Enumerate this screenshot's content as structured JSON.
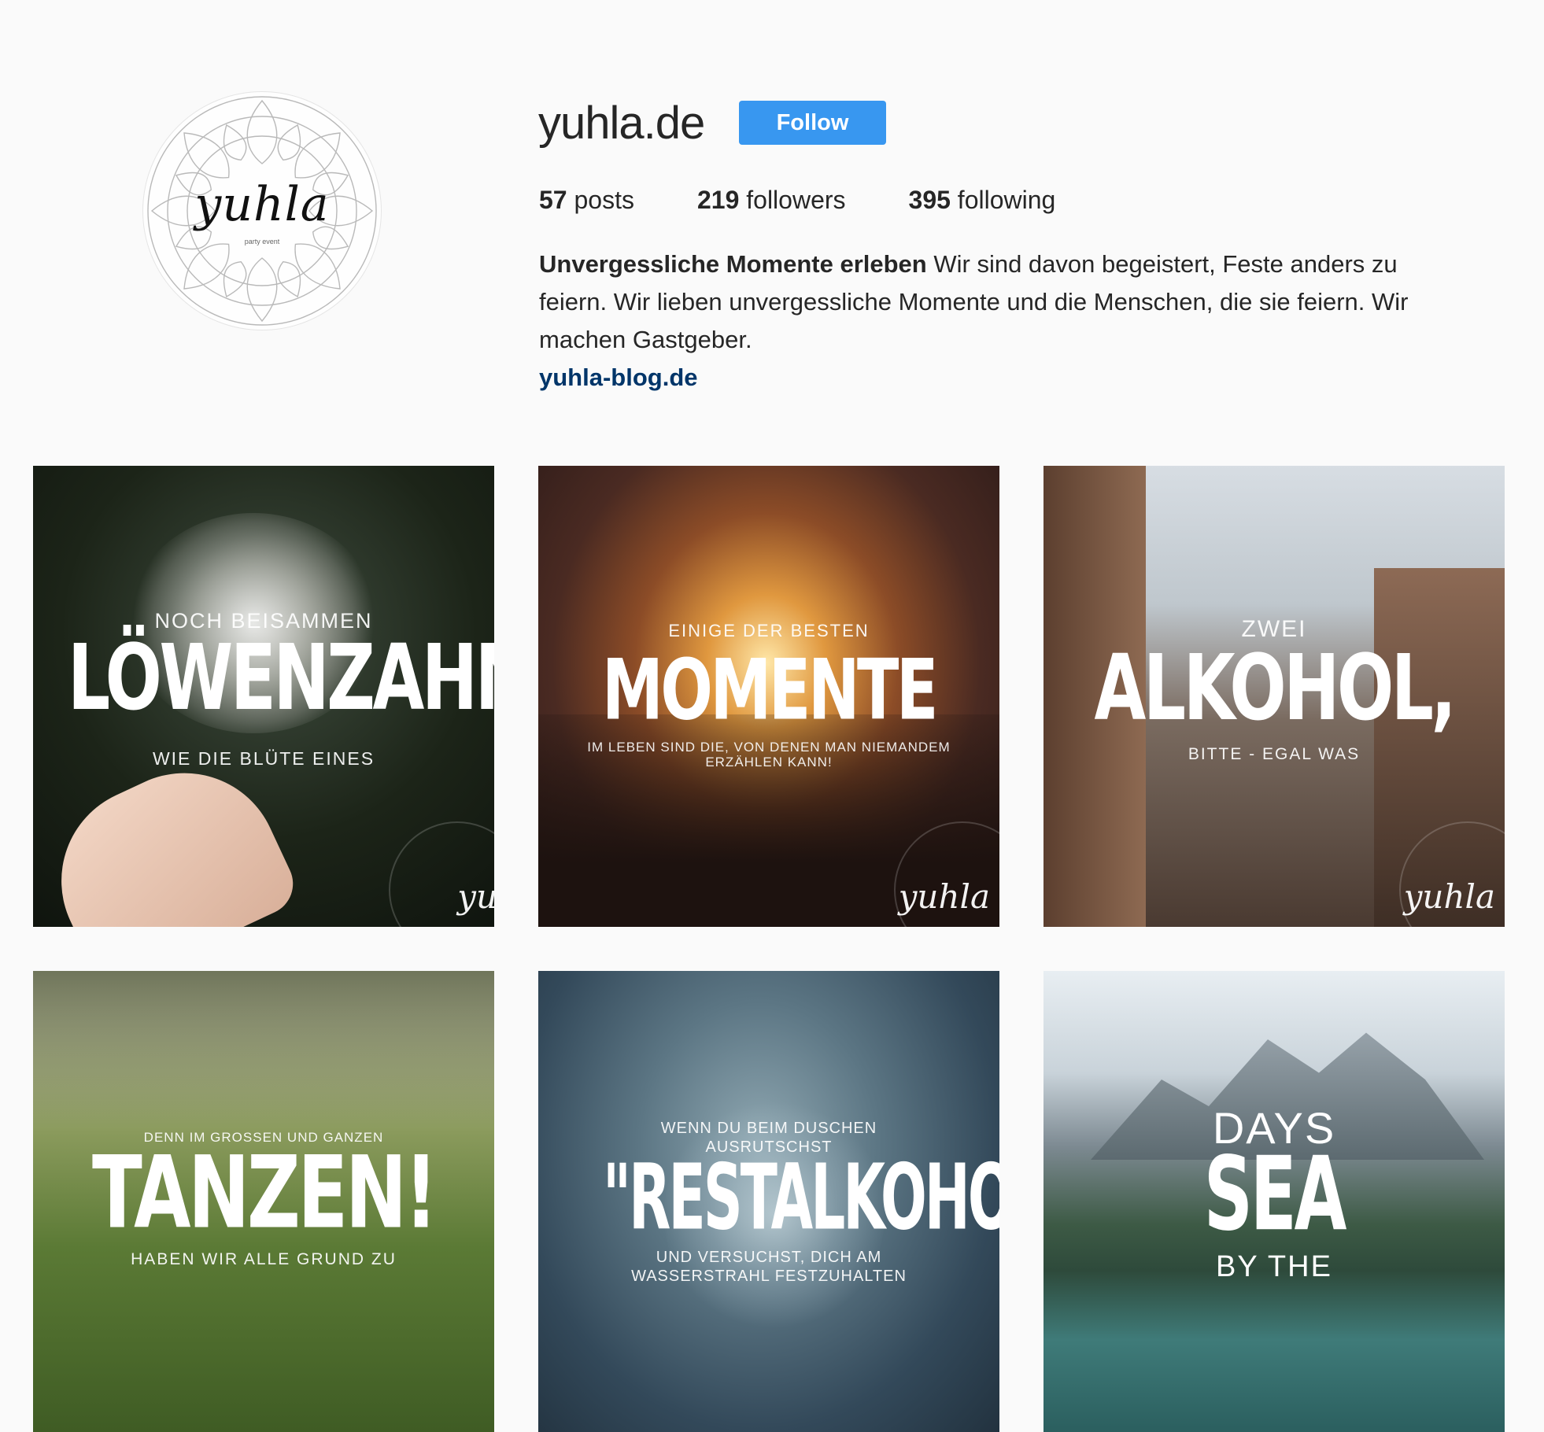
{
  "profile": {
    "avatar_wordmark": "yuhla",
    "avatar_subtitle": "party event",
    "username": "yuhla.de",
    "follow_label": "Follow",
    "stats": {
      "posts_count": "57",
      "posts_label": "posts",
      "followers_count": "219",
      "followers_label": "followers",
      "following_count": "395",
      "following_label": "following"
    },
    "bio": {
      "name": "Unvergessliche Momente erleben",
      "text": "Wir sind davon begeistert, Feste anders zu feiern. Wir lieben unvergessliche Momente und die Menschen, die sie feiern. Wir machen Gastgeber.",
      "link": "yuhla-blog.de"
    }
  },
  "posts": [
    {
      "top": "NOCH BEISAMMEN",
      "big": "LÖWENZAHN",
      "bottom": "WIE DIE BLÜTE EINES",
      "watermark": "yu"
    },
    {
      "top": "EINIGE DER BESTEN",
      "big": "MOMENTE",
      "bottom": "IM LEBEN SIND DIE, VON DENEN MAN NIEMANDEM ERZÄHLEN KANN!",
      "watermark": "yuhla"
    },
    {
      "top": "ZWEI",
      "big": "ALKOHOL,",
      "bottom": "BITTE - EGAL WAS",
      "watermark": "yuhla"
    },
    {
      "top": "DENN IM GROSSEN UND GANZEN",
      "big": "TANZEN!",
      "bottom": "HABEN WIR ALLE GRUND ZU"
    },
    {
      "top": "WENN DU BEIM DUSCHEN AUSRUTSCHST",
      "big": "\"RESTALKOHOL\"",
      "bottom": "UND VERSUCHST, DICH AM WASSERSTRAHL FESTZUHALTEN"
    },
    {
      "top": "DAYS",
      "big": "SEA",
      "bottom": "BY THE"
    }
  ],
  "colors": {
    "background": "#fafafa",
    "follow_button": "#3897f0",
    "link": "#003569",
    "text": "#262626"
  }
}
